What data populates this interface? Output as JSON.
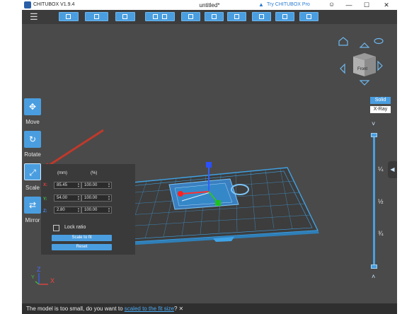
{
  "app": {
    "title": "CHITUBOX V1.9.4",
    "document": "untitled*",
    "promo": "Try CHITUBOX Pro"
  },
  "window_controls": {
    "minimize": "—",
    "maximize": "☐",
    "close": "✕"
  },
  "toolbar": {
    "menu_icon": "☰"
  },
  "view_cube": {
    "face": "Front",
    "home": "⌂",
    "eye": "👁"
  },
  "view_modes": {
    "solid": "Solid",
    "xray": "X-Ray"
  },
  "tools": [
    {
      "label": "Move",
      "glyph": "✥"
    },
    {
      "label": "Rotate",
      "glyph": "↻"
    },
    {
      "label": "Scale",
      "glyph": "⤢"
    },
    {
      "label": "Mirror",
      "glyph": "⇄"
    }
  ],
  "scale_panel": {
    "col_mm": "(mm)",
    "col_pct": "(%)",
    "rows": [
      {
        "axis": "X:",
        "mm": "85.45",
        "pct": "100.00",
        "color": "#e84040"
      },
      {
        "axis": "Y:",
        "mm": "54.00",
        "pct": "100.00",
        "color": "#4ac04a"
      },
      {
        "axis": "Z:",
        "mm": "2.80",
        "pct": "100.00",
        "color": "#4a8ef0"
      }
    ],
    "lock_ratio": "Lock ratio",
    "scale_to_fit": "Scale to fit",
    "reset": "Reset"
  },
  "slider": {
    "marks": [
      "¼",
      "½",
      "¾"
    ],
    "arrow_up": "˅",
    "arrow_down": "˄"
  },
  "axes_gizmo": {
    "x": "X",
    "y": "Y",
    "z": "Z"
  },
  "status": {
    "prefix": "The model is too small, do you want to ",
    "link": "scaled to the fit size",
    "suffix": "?",
    "close": "✕"
  },
  "colors": {
    "accent": "#4a9ee0",
    "background": "#4a4a4a",
    "plate": "#3fa3e6",
    "arrow": "#c0392b"
  }
}
